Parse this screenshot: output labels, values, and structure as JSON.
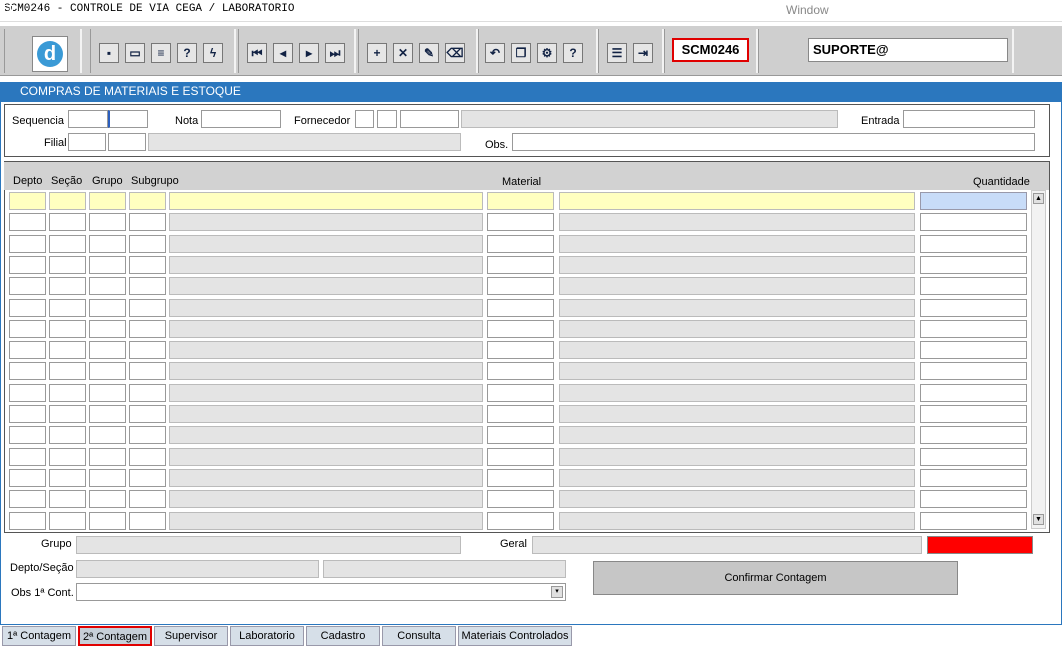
{
  "window": {
    "title": "SCM0246 - CONTROLE DE VIA CEGA / LABORATORIO",
    "menu": "Window"
  },
  "toolbar": {
    "form_code": "SCM0246",
    "user": "SUPORTE@",
    "icons": [
      "logo-icon",
      "save-icon",
      "window-icon",
      "print-icon",
      "query-help-icon",
      "execute-query-icon",
      "first-record-icon",
      "previous-record-icon",
      "next-record-icon",
      "last-record-icon",
      "insert-record-icon",
      "delete-record-icon",
      "edit-record-icon",
      "clear-icon",
      "undo-icon",
      "copy-icon",
      "settings-icon",
      "help-icon",
      "menu-icon",
      "exit-icon"
    ]
  },
  "panel": {
    "title": "COMPRAS DE MATERIAIS E ESTOQUE"
  },
  "header_fields": {
    "sequencia_label": "Sequencia",
    "nota_label": "Nota",
    "fornecedor_label": "Fornecedor",
    "entrada_label": "Entrada",
    "filial_label": "Filial",
    "obs_label": "Obs."
  },
  "grid": {
    "columns": [
      "Depto",
      "Seção",
      "Grupo",
      "Subgrupo",
      "Material",
      "Quantidade"
    ],
    "row_count": 16
  },
  "footer": {
    "grupo_label": "Grupo",
    "geral_label": "Geral",
    "depto_secao_label": "Depto/Seção",
    "obs_cont_label": "Obs 1ª Cont.",
    "confirm_button": "Confirmar Contagem",
    "alert_color": "#ff0000"
  },
  "tabs": [
    {
      "label": "1ª Contagem",
      "active": false
    },
    {
      "label": "2ª Contagem",
      "active": true
    },
    {
      "label": "Supervisor",
      "active": false
    },
    {
      "label": "Laboratorio",
      "active": false
    },
    {
      "label": "Cadastro",
      "active": false
    },
    {
      "label": "Consulta",
      "active": false
    },
    {
      "label": "Materiais Controlados",
      "active": false
    }
  ]
}
